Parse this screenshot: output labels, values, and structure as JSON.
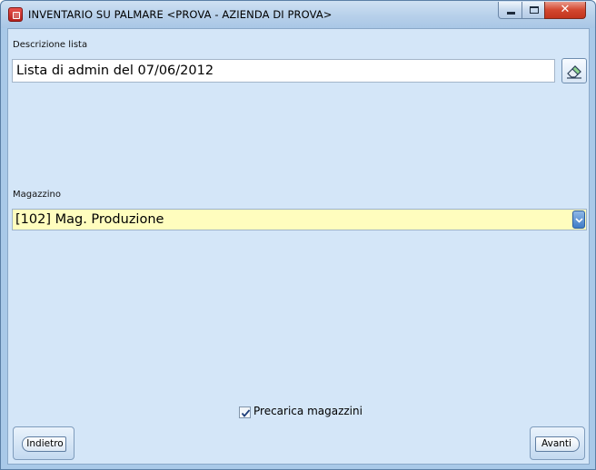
{
  "window": {
    "title": "INVENTARIO SU PALMARE <PROVA - AZIENDA DI PROVA>",
    "icon": "app-icon"
  },
  "caption_buttons": {
    "minimize": "minimize-icon",
    "maximize": "maximize-icon",
    "close": "close-icon",
    "close_glyph": "✕"
  },
  "description": {
    "label": "Descrizione lista",
    "value": "Lista di admin del 07/06/2012",
    "clear_icon": "eraser-icon"
  },
  "warehouse": {
    "label": "Magazzino",
    "selected": "[102] Mag. Produzione",
    "arrow_icon": "chevron-down-icon"
  },
  "preload": {
    "label": "Precarica magazzini",
    "checked": true
  },
  "navigation": {
    "back_label": "Indietro",
    "next_label": "Avanti"
  },
  "colors": {
    "client_background": "#d4e6f8",
    "select_background": "#fffdbe",
    "close_button": "#c2341d"
  }
}
